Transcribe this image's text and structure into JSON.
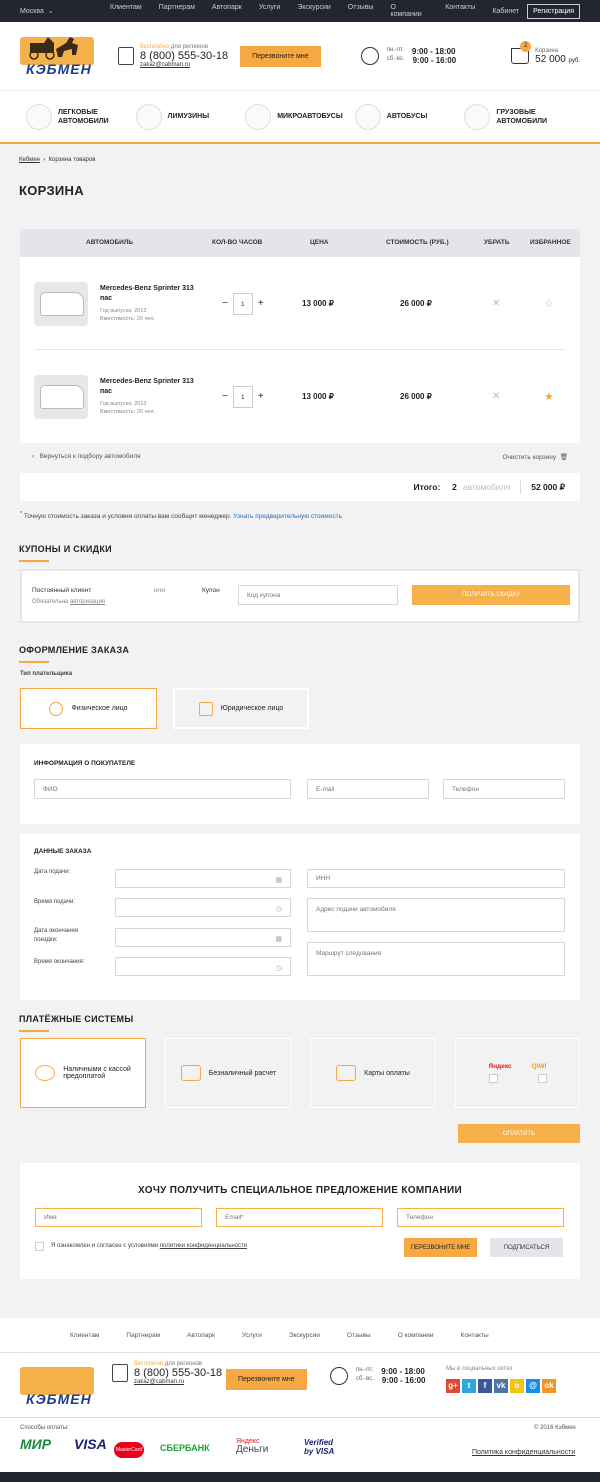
{
  "topbar": {
    "city": "Москва",
    "menu": [
      "Клиентам",
      "Партнерам",
      "Автопарк",
      "Услуги",
      "Экскурсии",
      "Отзывы",
      "О компании",
      "Контакты"
    ],
    "cabinet": "Кабинет",
    "register": "Регистрация"
  },
  "header": {
    "logo": "КЭБМЕН",
    "free": "бесплатно",
    "free_rest": "для регионов",
    "phone": "8 (800) 555-30-18",
    "email": "zakaz@cabman.ru",
    "callback": "Перезвоните мне",
    "days1": "пн.-пт.",
    "hours1": "9:00 - 18:00",
    "days2": "сб.-вс.",
    "hours2": "9:00 - 16:00",
    "cart_label": "Корзина",
    "cart_sum": "52 000",
    "cart_cur": "руб.",
    "cart_count": "2"
  },
  "categories": [
    {
      "l1": "ЛЕГКОВЫЕ",
      "l2": "АВТОМОБИЛИ"
    },
    {
      "l1": "ЛИМУЗИНЫ",
      "l2": ""
    },
    {
      "l1": "МИКРОАВТОБУСЫ",
      "l2": ""
    },
    {
      "l1": "АВТОБУСЫ",
      "l2": ""
    },
    {
      "l1": "ГРУЗОВЫЕ",
      "l2": "АВТОМОБИЛИ"
    }
  ],
  "breadcrumb": {
    "home": "Кебмен",
    "sep": "›",
    "current": "Корзина товаров"
  },
  "page_title": "КОРЗИНА",
  "cart": {
    "headers": [
      "АВТОМОБИЛЬ",
      "КОЛ-ВО ЧАСОВ",
      "ЦЕНА",
      "СТОИМОСТЬ (РУБ.)",
      "УБРАТЬ",
      "ИЗБРАННОЕ"
    ],
    "items": [
      {
        "title": "Mercedes-Benz Sprinter 313 пас",
        "year": "Год выпуска: 2013",
        "cap": "Вместимость: 20 чел.",
        "qty": "1",
        "price": "13 000 ₽",
        "total": "26 000 ₽",
        "favorite": false
      },
      {
        "title": "Mercedes-Benz Sprinter 313 пас",
        "year": "Год выпуска: 2013",
        "cap": "Вместимость: 20 чел.",
        "qty": "1",
        "price": "13 000 ₽",
        "total": "26 000 ₽",
        "favorite": true
      }
    ],
    "back": "Вернуться к подбору автомобиля",
    "clear": "Очистить корзину",
    "total_label": "Итого:",
    "total_count": "2",
    "total_unit": "автомобиля",
    "total_sum": "52 000 ₽"
  },
  "note": {
    "text": "Точную стоимость заказа и условия оплаты вам сообщит менеджер.",
    "link": "Узнать предварительную стоимость"
  },
  "coupons": {
    "title": "КУПОНЫ И СКИДКИ",
    "regular": "Постоянный клиент",
    "need": "Обязательна",
    "auth": "авторизация",
    "or": "или",
    "coupon": "Купон",
    "placeholder": "Код купона",
    "btn": "ПОЛУЧИТЬ СКИДКУ"
  },
  "order": {
    "title": "ОФОРМЛЕНИЕ ЗАКАЗА",
    "payer": "Тип плательщика",
    "individual": "Физическое лицо",
    "legal": "Юридическое лицо",
    "buyer_title": "ИНФОРМАЦИЯ О ПОКУПАТЕЛЕ",
    "fio": "ФИО",
    "email": "E-mail",
    "phone": "Телефон",
    "data_title": "ДАННЫЕ ЗАКАЗА",
    "d1": "Дата подачи:",
    "d2": "Время подачи:",
    "d3a": "Дата окончания",
    "d3b": "поездки:",
    "d4": "Время окончания:",
    "inn": "ИНН",
    "address": "Адрес подачи автомобиля",
    "route": "Маршрут следования"
  },
  "payment": {
    "title": "ПЛАТЁЖНЫЕ СИСТЕМЫ",
    "cash1": "Наличными с кассой",
    "cash2": "предоплатой",
    "cashless": "Безналичный расчет",
    "cards": "Карты оплаты",
    "yandex": "Яндекс",
    "qiwi": "QIWI",
    "pay_btn": "ОПЛАТИТЬ"
  },
  "lead": {
    "title": "ХОЧУ ПОЛУЧИТЬ СПЕЦИАЛЬНОЕ ПРЕДЛОЖЕНИЕ КОМПАНИИ",
    "name": "Имя",
    "email": "Email*",
    "phone": "Телефон",
    "agree": "Я ознакомлен и согласен с условиями",
    "policy": "политики конфиденциальности",
    "callback": "ПЕРЕЗВОНИТЕ МНЕ",
    "subscribe": "ПОДПИСАТЬСЯ"
  },
  "footer": {
    "menu": [
      "Клиентам",
      "Партнерам",
      "Автопарк",
      "Услуги",
      "Экскурсии",
      "Отзывы",
      "О компании",
      "Контакты"
    ],
    "social_label": "Мы в социальных сетях",
    "pay_label": "Способы оплаты:",
    "copyright": "© 2016 Кэбмен",
    "policy": "Политика конфиденциальности",
    "pay_logos": [
      "МИР",
      "VISA",
      "MasterCard",
      "СБЕРБАНК",
      "Яндекс",
      "Деньги",
      "Verified",
      "by VISA"
    ],
    "social": [
      {
        "t": "g+",
        "c": "#dc4a38"
      },
      {
        "t": "t",
        "c": "#2ea7e0"
      },
      {
        "t": "f",
        "c": "#3b5998"
      },
      {
        "t": "vk",
        "c": "#4c75a3"
      },
      {
        "t": "o",
        "c": "#f1c40f"
      },
      {
        "t": "@",
        "c": "#168de2"
      },
      {
        "t": "ok",
        "c": "#f7931e"
      }
    ]
  },
  "colors": {
    "accent": "#f6a843",
    "dark": "#23262f",
    "link": "#2a6fb5"
  }
}
